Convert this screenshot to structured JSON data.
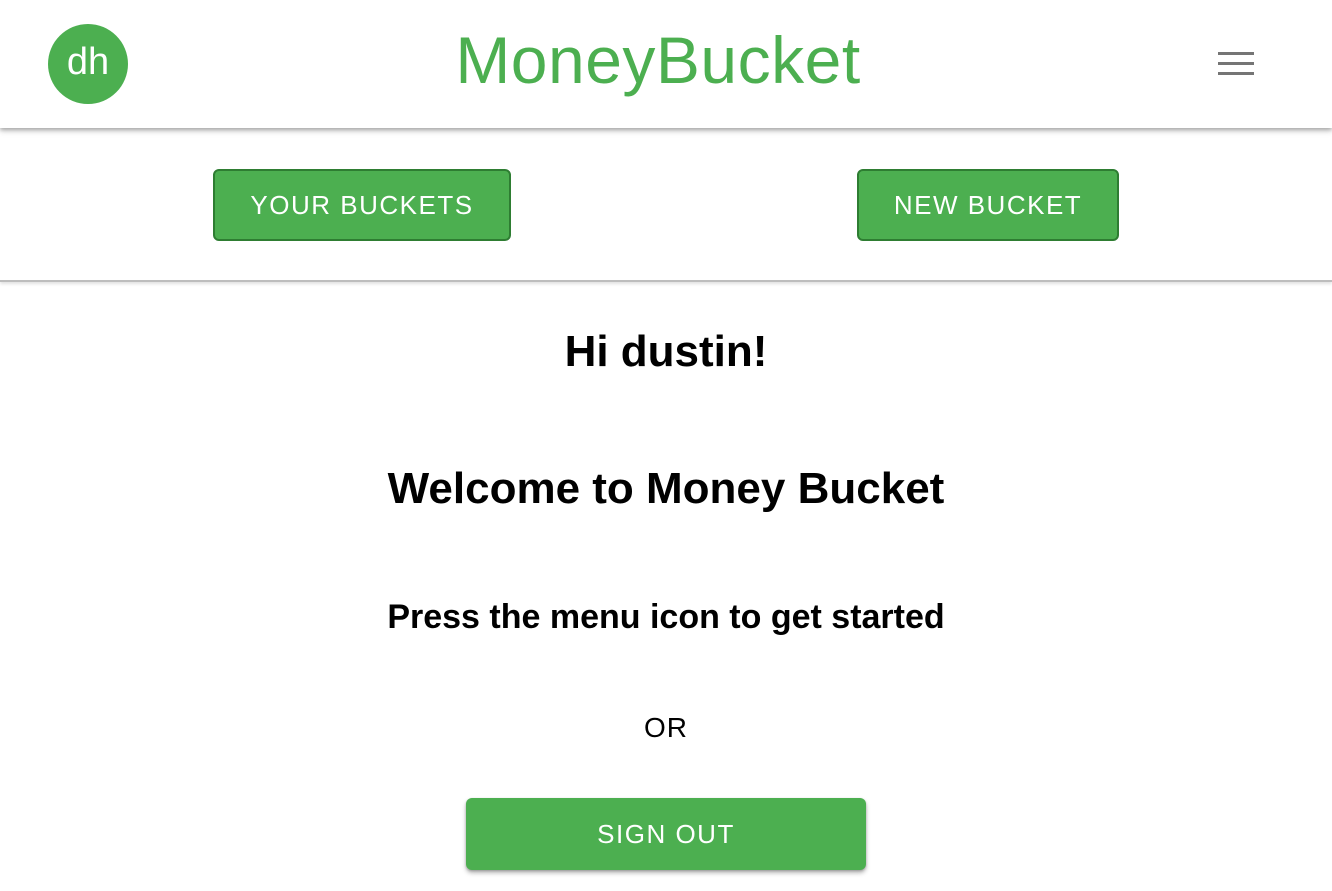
{
  "header": {
    "avatar_initials": "dh",
    "brand_title": "MoneyBucket",
    "menu_icon": "hamburger-menu-icon"
  },
  "actions": {
    "your_buckets_label": "YOUR BUCKETS",
    "new_bucket_label": "NEW BUCKET"
  },
  "main": {
    "greeting": "Hi dustin!",
    "welcome": "Welcome to Money Bucket",
    "instructions": "Press the menu icon to get started",
    "or_text": "OR",
    "sign_out_label": "SIGN OUT"
  },
  "colors": {
    "brand_green": "#4caf50",
    "button_border": "#2e7d32",
    "menu_icon_gray": "#757575",
    "text": "#000000",
    "background": "#ffffff"
  }
}
